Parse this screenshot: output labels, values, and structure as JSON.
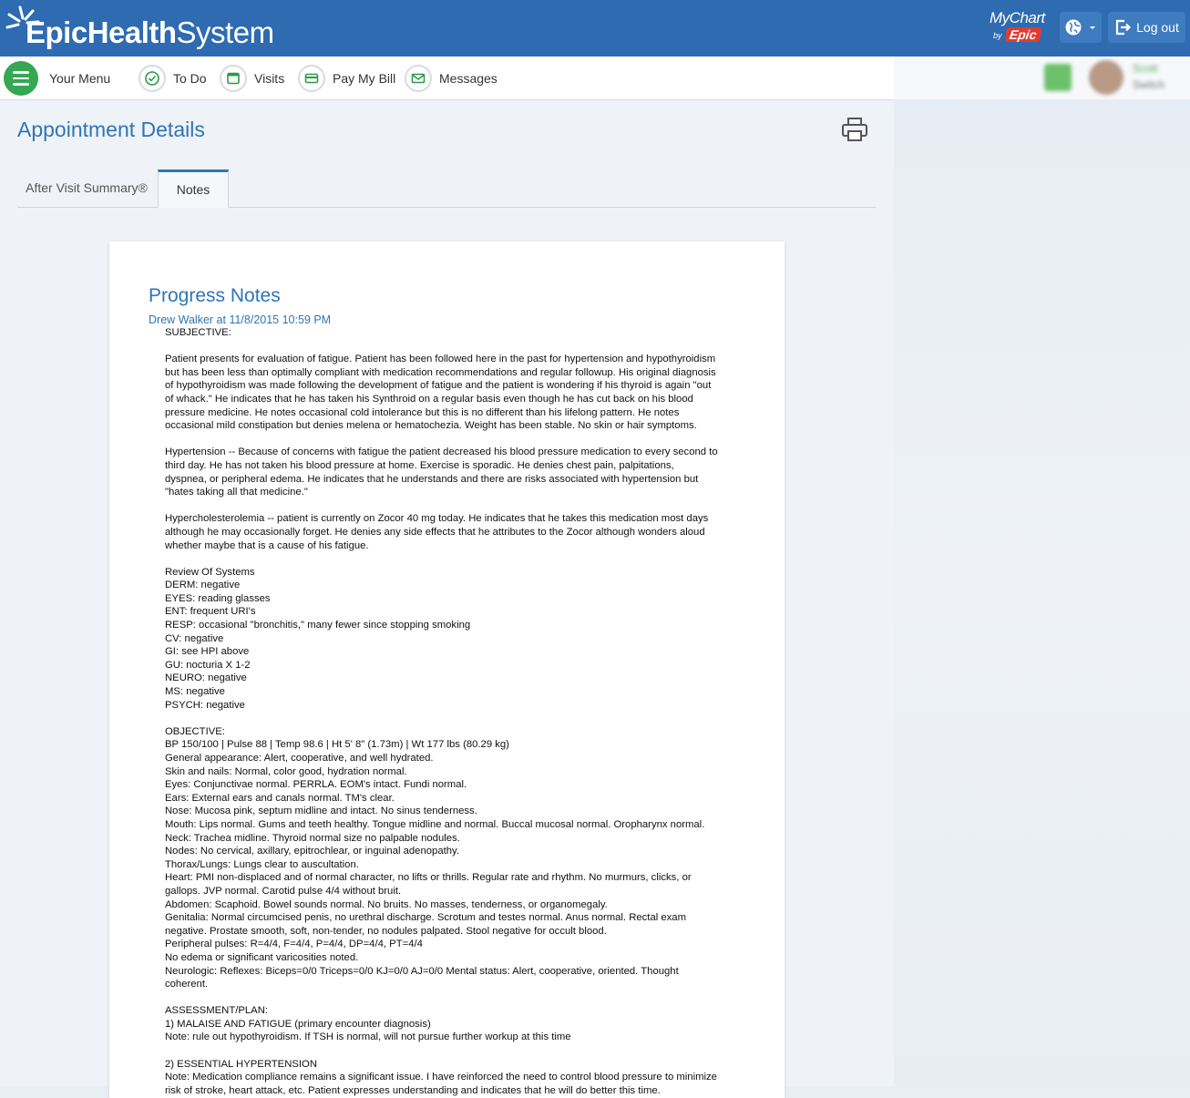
{
  "header": {
    "brand_bold": "EpicHealth",
    "brand_light": "System",
    "mychart": "MyChart",
    "by": "by",
    "epic": "Epic",
    "logout_label": "Log out"
  },
  "nav": {
    "menu_label": "Your Menu",
    "items": [
      {
        "label": "To Do"
      },
      {
        "label": "Visits"
      },
      {
        "label": "Pay My Bill"
      },
      {
        "label": "Messages"
      }
    ],
    "user_name": "Scott",
    "switch_label": "Switch"
  },
  "page": {
    "title": "Appointment Details",
    "tabs": [
      {
        "label": "After Visit Summary®"
      },
      {
        "label": "Notes"
      }
    ]
  },
  "note": {
    "title": "Progress Notes",
    "author_line": "Drew Walker at 11/8/2015 10:59 PM",
    "body": "SUBJECTIVE:\n\nPatient presents for evaluation of fatigue. Patient has been followed here in the past for hypertension and hypothyroidism\nbut has been less than optimally compliant with medication recommendations and regular followup. His original diagnosis\nof hypothyroidism was made following the development of fatigue and the patient is wondering if his thyroid is again \"out\nof whack.\" He indicates that he has taken his Synthroid on a regular basis even though he has cut back on his blood\npressure medicine. He notes occasional cold intolerance but this is no different than his lifelong pattern. He notes\noccasional mild constipation but denies melena or hematochezia. Weight has been stable. No skin or hair symptoms.\n\nHypertension -- Because of concerns with fatigue the patient decreased his blood pressure medication to every second to\nthird day. He has not taken his blood pressure at home. Exercise is sporadic. He denies chest pain, palpitations,\ndyspnea, or peripheral edema. He indicates that he understands and there are risks associated with hypertension but\n\"hates taking all that medicine.\"\n\nHypercholesterolemia -- patient is currently on Zocor 40 mg today. He indicates that he takes this medication most days\nalthough he may occasionally forget. He denies any side effects that he attributes to the Zocor although wonders aloud\nwhether maybe that is a cause of his fatigue.\n\nReview Of Systems\nDERM: negative\nEYES: reading glasses\nENT: frequent URI's\nRESP: occasional \"bronchitis,\" many fewer since stopping smoking\nCV: negative\nGI: see HPI above\nGU: nocturia X 1-2\nNEURO: negative\nMS: negative\nPSYCH: negative\n\nOBJECTIVE:\nBP 150/100 | Pulse 88 | Temp 98.6 | Ht 5' 8\" (1.73m) | Wt 177 lbs (80.29 kg)\nGeneral appearance: Alert, cooperative, and well hydrated.\nSkin and nails: Normal, color good, hydration normal.\nEyes: Conjunctivae normal. PERRLA. EOM's intact. Fundi normal.\nEars: External ears and canals normal. TM's clear.\nNose: Mucosa pink, septum midline and intact. No sinus tenderness.\nMouth: Lips normal. Gums and teeth healthy. Tongue midline and normal. Buccal mucosal normal. Oropharynx normal.\nNeck: Trachea midline. Thyroid normal size no palpable nodules.\nNodes: No cervical, axillary, epitrochlear, or inguinal adenopathy.\nThorax/Lungs: Lungs clear to auscultation.\nHeart: PMI non-displaced and of normal character, no lifts or thrills. Regular rate and rhythm. No murmurs, clicks, or\ngallops. JVP normal. Carotid pulse 4/4 without bruit.\nAbdomen: Scaphoid. Bowel sounds normal. No bruits. No masses, tenderness, or organomegaly.\nGenitalia: Normal circumcised penis, no urethral discharge. Scrotum and testes normal. Anus normal. Rectal exam\nnegative. Prostate smooth, soft, non-tender, no nodules palpated. Stool negative for occult blood.\nPeripheral pulses: R=4/4, F=4/4, P=4/4, DP=4/4, PT=4/4\nNo edema or significant varicosities noted.\nNeurologic: Reflexes: Biceps=0/0 Triceps=0/0 KJ=0/0 AJ=0/0 Mental status: Alert, cooperative, oriented. Thought\ncoherent.\n\nASSESSMENT/PLAN:\n1) MALAISE AND FATIGUE (primary encounter diagnosis)\nNote: rule out hypothyroidism. If TSH is normal, will not pursue further workup at this time\n\n2) ESSENTIAL HYPERTENSION\nNote: Medication compliance remains a significant issue. I have reinforced the need to control blood pressure to minimize\nrisk of stroke, heart attack, etc. Patient expresses understanding and indicates that he will do better this time."
  },
  "colors": {
    "header_blue": "#2e6bb0",
    "link_blue": "#2e75b8",
    "menu_green": "#34a853",
    "icon_green": "#2e9a47"
  }
}
